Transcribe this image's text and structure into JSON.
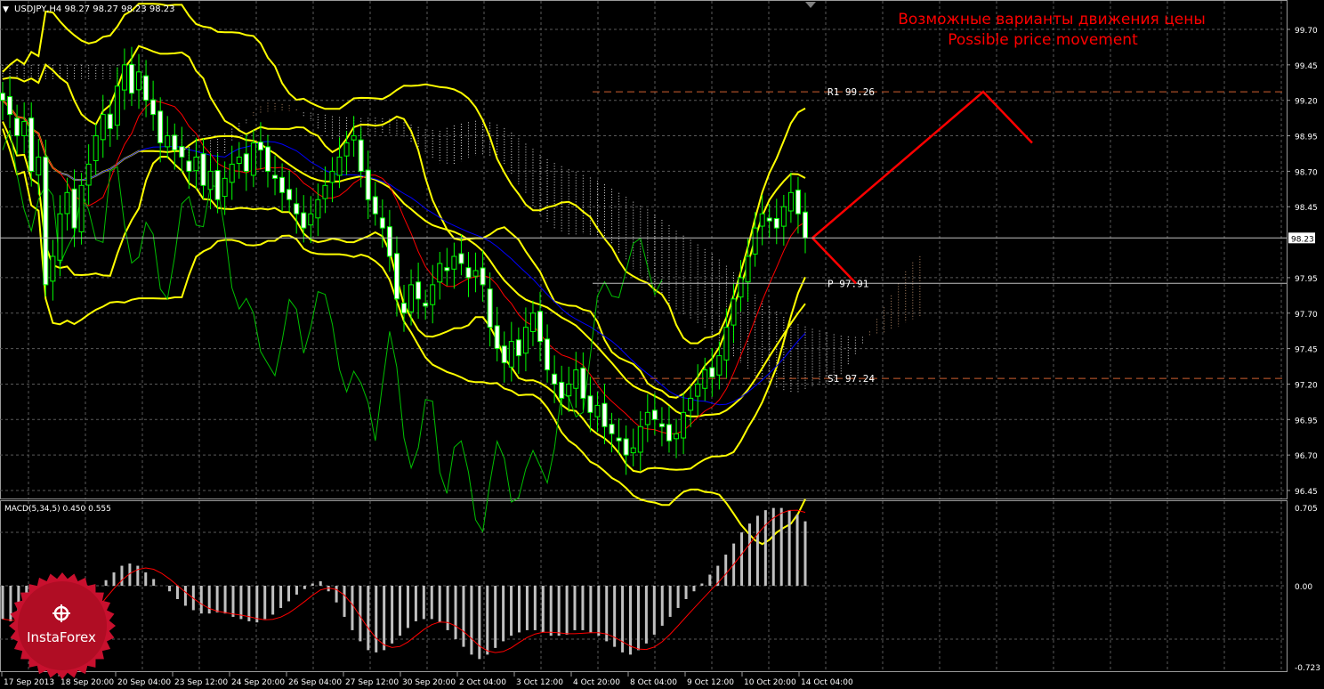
{
  "window": {
    "title": "USDJPY,H4  98.27 98.27 98.23 98.23",
    "menu_marker": "▼"
  },
  "annotation": {
    "line1": "Возможные варианты движения цены",
    "line2": "Possible price movement"
  },
  "colors": {
    "background": "#000000",
    "grid": "#5a5a5a",
    "bull_candle": "#00ff00",
    "bear_candle": "#ffffff",
    "bands": "#ffff00",
    "kijun": "#0000ff",
    "tenkan": "#ff0000",
    "chikou": "#00c000",
    "cloud_up": "#d4a27a",
    "cloud_down": "#ffffff",
    "level_line": "#d06030",
    "forecast": "#ff0000",
    "macd_hist": "#c0c0c0",
    "macd_signal": "#ff0000",
    "annotation": "#ff0000",
    "logo": "#c8102e"
  },
  "price_axis": {
    "labels": [
      "99.70",
      "99.45",
      "99.20",
      "98.95",
      "98.70",
      "98.45",
      "98.23",
      "97.95",
      "97.70",
      "97.45",
      "97.20",
      "96.95",
      "96.70",
      "96.45"
    ],
    "current_price": "98.23"
  },
  "levels": [
    {
      "name": "R1",
      "label": "R1 99.26",
      "value": 99.26
    },
    {
      "name": "P",
      "label": "P 97.91",
      "value": 97.91
    },
    {
      "name": "S1",
      "label": "S1 97.24",
      "value": 97.24
    }
  ],
  "time_axis": {
    "labels": [
      "17 Sep 2013",
      "18 Sep 20:00",
      "20 Sep 04:00",
      "23 Sep 12:00",
      "24 Sep 20:00",
      "26 Sep 04:00",
      "27 Sep 12:00",
      "30 Sep 20:00",
      "2 Oct 04:00",
      "3 Oct 12:00",
      "4 Oct 20:00",
      "8 Oct 04:00",
      "9 Oct 12:00",
      "10 Oct 20:00",
      "14 Oct 04:00"
    ]
  },
  "macd": {
    "label": "MACD(5,34,5) 0.450 0.555",
    "axis_labels": [
      "0.705",
      "0.00",
      "-0.723"
    ]
  },
  "logo": {
    "text": "InstaForex",
    "icon": "gear-icon"
  },
  "chart_data": {
    "type": "candlestick",
    "title": "USDJPY,H4",
    "y_range": [
      96.4,
      99.85
    ],
    "close": [
      99.2,
      99.1,
      98.95,
      99.05,
      98.7,
      98.8,
      97.9,
      98.1,
      98.4,
      98.55,
      98.3,
      98.6,
      98.75,
      98.95,
      99.1,
      99.0,
      99.3,
      99.45,
      99.25,
      99.4,
      99.2,
      99.1,
      98.9,
      98.95,
      98.85,
      98.8,
      98.7,
      98.8,
      98.6,
      98.7,
      98.5,
      98.65,
      98.75,
      98.8,
      98.7,
      98.9,
      98.85,
      98.7,
      98.65,
      98.55,
      98.5,
      98.4,
      98.3,
      98.4,
      98.5,
      98.6,
      98.7,
      98.8,
      98.9,
      98.95,
      98.7,
      98.5,
      98.4,
      98.3,
      98.1,
      97.8,
      97.7,
      97.9,
      97.8,
      97.75,
      97.9,
      98.05,
      98.0,
      98.1,
      98.05,
      97.95,
      98.0,
      97.9,
      97.6,
      97.45,
      97.35,
      97.5,
      97.4,
      97.6,
      97.7,
      97.5,
      97.3,
      97.2,
      97.1,
      97.2,
      97.3,
      97.1,
      97.0,
      97.05,
      96.9,
      96.85,
      96.8,
      96.7,
      96.75,
      96.9,
      97.0,
      96.95,
      96.9,
      96.8,
      96.85,
      97.0,
      97.1,
      97.2,
      97.3,
      97.25,
      97.4,
      97.6,
      97.8,
      97.95,
      98.1,
      98.3,
      98.4,
      98.35,
      98.3,
      98.45,
      98.55,
      98.4,
      98.23
    ],
    "macd_histogram": [
      -0.3,
      -0.32,
      -0.32,
      -0.3,
      -0.32,
      -0.35,
      -0.4,
      -0.42,
      -0.4,
      -0.3,
      -0.2,
      -0.1,
      0.0,
      0.05,
      0.12,
      0.18,
      0.2,
      0.18,
      0.12,
      0.06,
      0.0,
      -0.05,
      -0.12,
      -0.18,
      -0.22,
      -0.25,
      -0.25,
      -0.24,
      -0.25,
      -0.28,
      -0.3,
      -0.32,
      -0.33,
      -0.3,
      -0.26,
      -0.2,
      -0.14,
      -0.08,
      -0.03,
      0.02,
      0.04,
      -0.05,
      -0.15,
      -0.28,
      -0.4,
      -0.5,
      -0.58,
      -0.6,
      -0.58,
      -0.52,
      -0.45,
      -0.38,
      -0.32,
      -0.3,
      -0.3,
      -0.33,
      -0.4,
      -0.48,
      -0.55,
      -0.62,
      -0.66,
      -0.62,
      -0.56,
      -0.5,
      -0.45,
      -0.42,
      -0.4,
      -0.4,
      -0.42,
      -0.45,
      -0.45,
      -0.44,
      -0.4,
      -0.4,
      -0.42,
      -0.45,
      -0.5,
      -0.55,
      -0.6,
      -0.62,
      -0.58,
      -0.52,
      -0.44,
      -0.36,
      -0.28,
      -0.2,
      -0.12,
      -0.05,
      0.02,
      0.1,
      0.18,
      0.28,
      0.38,
      0.48,
      0.56,
      0.63,
      0.68,
      0.7,
      0.7,
      0.68,
      0.64,
      0.58
    ],
    "forecast_path": [
      98.23,
      99.26,
      98.9
    ],
    "forecast_path_down": [
      98.23,
      97.91
    ]
  }
}
